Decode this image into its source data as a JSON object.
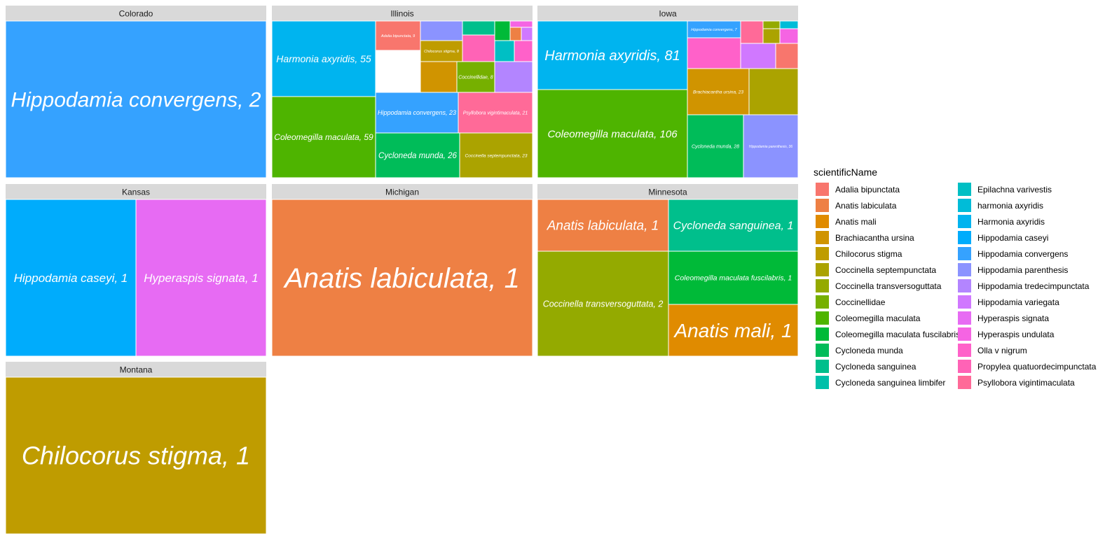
{
  "chart_data": {
    "type": "treemap",
    "facet_variable": "stateProvince",
    "fill_variable": "scientificName",
    "legend": {
      "title": "scientificName",
      "position": "right",
      "entries": [
        {
          "name": "Adalia bipunctata",
          "color": "#F8766D"
        },
        {
          "name": "Anatis labiculata",
          "color": "#EE8044"
        },
        {
          "name": "Anatis mali",
          "color": "#E08B00"
        },
        {
          "name": "Brachiacantha ursina",
          "color": "#D09400"
        },
        {
          "name": "Chilocorus stigma",
          "color": "#BF9C00"
        },
        {
          "name": "Coccinella septempunctata",
          "color": "#ABA300"
        },
        {
          "name": "Coccinella transversoguttata",
          "color": "#94AA00"
        },
        {
          "name": "Coccinellidae",
          "color": "#76B000"
        },
        {
          "name": "Coleomegilla maculata",
          "color": "#4EB400"
        },
        {
          "name": "Coleomegilla maculata fuscilabris",
          "color": "#00BA38"
        },
        {
          "name": "Cycloneda munda",
          "color": "#00BC59"
        },
        {
          "name": "Cycloneda sanguinea",
          "color": "#00BF8C"
        },
        {
          "name": "Cycloneda sanguinea limbifer",
          "color": "#00C0AA"
        },
        {
          "name": "Epilachna varivestis",
          "color": "#00BFC4"
        },
        {
          "name": "harmonia axyridis",
          "color": "#00BCD8"
        },
        {
          "name": "Harmonia axyridis",
          "color": "#00B4EF"
        },
        {
          "name": "Hippodamia caseyi",
          "color": "#00ACFC"
        },
        {
          "name": "Hippodamia convergens",
          "color": "#35A2FF"
        },
        {
          "name": "Hippodamia parenthesis",
          "color": "#8B93FF"
        },
        {
          "name": "Hippodamia tredecimpunctata",
          "color": "#B385FF"
        },
        {
          "name": "Hippodamia variegata",
          "color": "#D078FF"
        },
        {
          "name": "Hyperaspis signata",
          "color": "#E76BF3"
        },
        {
          "name": "Hyperaspis undulata",
          "color": "#F564E3"
        },
        {
          "name": "Olla v nigrum",
          "color": "#FF61C9"
        },
        {
          "name": "Propylea quatuordecimpunctata",
          "color": "#FF63B6"
        },
        {
          "name": "Psyllobora vigintimaculata",
          "color": "#FF6A98"
        }
      ]
    },
    "facets": [
      {
        "name": "Colorado",
        "tiles": [
          {
            "species": "Hippodamia convergens",
            "count": 2,
            "label": "Hippodamia convergens, 2"
          }
        ]
      },
      {
        "name": "Illinois",
        "tiles": [
          {
            "species": "Harmonia axyridis",
            "count": 55,
            "label": "Harmonia axyridis, 55"
          },
          {
            "species": "Coleomegilla maculata",
            "count": 59,
            "label": "Coleomegilla maculata, 59"
          },
          {
            "species": "Adalia bipunctata",
            "count": 9,
            "label": "Adalia bipunctata, 9"
          },
          {
            "species": "Hippodamia parenthesis",
            "count": null,
            "label": ""
          },
          {
            "species": "Cycloneda sanguinea",
            "count": null,
            "label": ""
          },
          {
            "species": "Chilocorus stigma",
            "count": 8,
            "label": "Chilocorus stigma, 8"
          },
          {
            "species": "Propylea quatuordecimpunctata",
            "count": null,
            "label": ""
          },
          {
            "species": "Brachiacantha ursina",
            "count": null,
            "label": ""
          },
          {
            "species": "Coccinellidae",
            "count": 8,
            "label": "Coccinellidae, 8"
          },
          {
            "species": "Hippodamia tredecimpunctata",
            "count": null,
            "label": ""
          },
          {
            "species": "Coleomegilla maculata fuscilabris",
            "count": null,
            "label": ""
          },
          {
            "species": "Epilachna varivestis",
            "count": null,
            "label": ""
          },
          {
            "species": "Olla v nigrum",
            "count": null,
            "label": ""
          },
          {
            "species": "Hyperaspis undulata",
            "count": null,
            "label": ""
          },
          {
            "species": "Anatis labiculata",
            "count": null,
            "label": ""
          },
          {
            "species": "Hippodamia variegata",
            "count": null,
            "label": ""
          },
          {
            "species": "Hippodamia convergens",
            "count": 23,
            "label": "Hippodamia convergens, 23"
          },
          {
            "species": "Psyllobora vigintimaculata",
            "count": 21,
            "label": "Psyllobora vigintimaculata, 21"
          },
          {
            "species": "Cycloneda munda",
            "count": 26,
            "label": "Cycloneda munda, 26"
          },
          {
            "species": "Coccinella septempunctata",
            "count": 23,
            "label": "Coccinella septempunctata, 23"
          }
        ]
      },
      {
        "name": "Iowa",
        "tiles": [
          {
            "species": "Harmonia axyridis",
            "count": 81,
            "label": "Harmonia axyridis, 81"
          },
          {
            "species": "Coleomegilla maculata",
            "count": 106,
            "label": "Coleomegilla maculata, 106"
          },
          {
            "species": "Hippodamia convergens",
            "count": 7,
            "label": "Hippodamia convergens, 7"
          },
          {
            "species": "Psyllobora vigintimaculata",
            "count": null,
            "label": ""
          },
          {
            "species": "Coccinella transversoguttata",
            "count": null,
            "label": ""
          },
          {
            "species": "harmonia axyridis",
            "count": null,
            "label": ""
          },
          {
            "species": "Coccinella septempunctata",
            "count": null,
            "label": ""
          },
          {
            "species": "Hyperaspis undulata",
            "count": null,
            "label": ""
          },
          {
            "species": "Olla v nigrum",
            "count": null,
            "label": ""
          },
          {
            "species": "Hippodamia variegata",
            "count": null,
            "label": ""
          },
          {
            "species": "Adalia bipunctata",
            "count": null,
            "label": ""
          },
          {
            "species": "Brachiacantha ursina",
            "count": 23,
            "label": "Brachiacantha ursina, 23"
          },
          {
            "species": "Coccinella septempunctata",
            "count": null,
            "label": ""
          },
          {
            "species": "Cycloneda munda",
            "count": 28,
            "label": "Cycloneda munda, 28"
          },
          {
            "species": "Hippodamia parenthesis",
            "count": 36,
            "label": "Hippodamia parenthesis, 36"
          }
        ]
      },
      {
        "name": "Kansas",
        "tiles": [
          {
            "species": "Hippodamia caseyi",
            "count": 1,
            "label": "Hippodamia caseyi, 1"
          },
          {
            "species": "Hyperaspis signata",
            "count": 1,
            "label": "Hyperaspis signata, 1"
          }
        ]
      },
      {
        "name": "Michigan",
        "tiles": [
          {
            "species": "Anatis labiculata",
            "count": 1,
            "label": "Anatis labiculata, 1"
          }
        ]
      },
      {
        "name": "Minnesota",
        "tiles": [
          {
            "species": "Anatis labiculata",
            "count": 1,
            "label": "Anatis labiculata, 1"
          },
          {
            "species": "Cycloneda sanguinea",
            "count": 1,
            "label": "Cycloneda sanguinea, 1"
          },
          {
            "species": "Coccinella transversoguttata",
            "count": 2,
            "label": "Coccinella transversoguttata, 2"
          },
          {
            "species": "Coleomegilla maculata fuscilabris",
            "count": 1,
            "label": "Coleomegilla maculata fuscilabris, 1"
          },
          {
            "species": "Anatis mali",
            "count": 1,
            "label": "Anatis mali, 1"
          }
        ]
      },
      {
        "name": "Montana",
        "tiles": [
          {
            "species": "Chilocorus stigma",
            "count": 1,
            "label": "Chilocorus stigma, 1"
          }
        ]
      }
    ]
  }
}
